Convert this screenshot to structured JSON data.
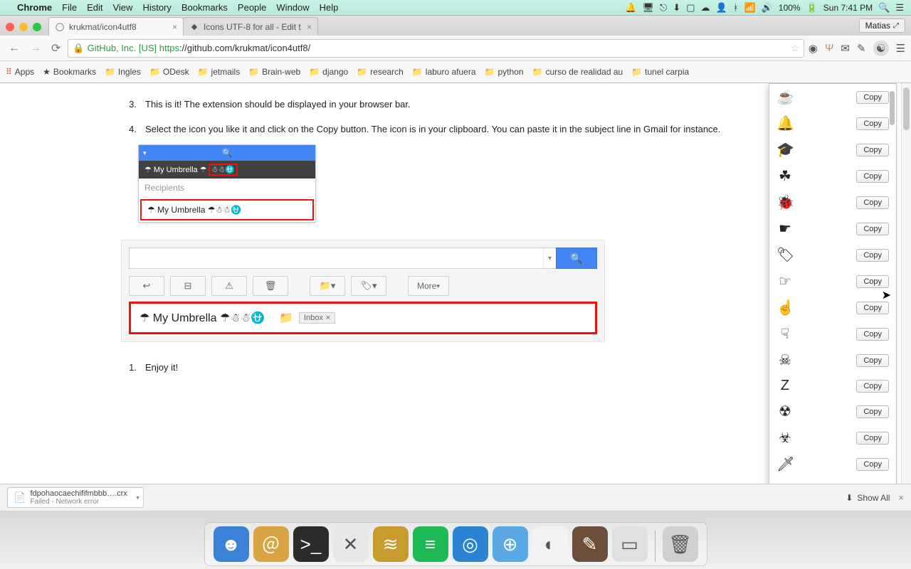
{
  "menubar": {
    "app": "Chrome",
    "items": [
      "File",
      "Edit",
      "View",
      "History",
      "Bookmarks",
      "People",
      "Window",
      "Help"
    ],
    "battery": "100%",
    "clock": "Sun 7:41 PM"
  },
  "chrome": {
    "tabs": [
      {
        "title": "krukmat/icon4utf8"
      },
      {
        "title": "Icons UTF-8 for all - Edit t"
      }
    ],
    "profile": "Matias",
    "url_secure": "GitHub, Inc. [US]",
    "url_prefix": "https",
    "url_rest": "://github.com/krukmat/icon4utf8/",
    "bookmarks": [
      "Apps",
      "Bookmarks",
      "Ingles",
      "ODesk",
      "jetmails",
      "Brain-web",
      "django",
      "research",
      "laburo afuera",
      "python",
      "curso de realidad au",
      "tunel carpia"
    ]
  },
  "page": {
    "step3_num": "3.",
    "step3": "This is it! The extension should be displayed in your browser bar.",
    "step4_num": "4.",
    "step4": "Select the icon you like it and click on the Copy button. The icon is in your clipboard. You can paste it in the subject line in Gmail for instance.",
    "compose_subject_dark": "☂ My Umbrella ☂",
    "compose_subject_icons": "☃☃⛎",
    "recipients_label": "Recipients",
    "compose_subject_line": "☂ My Umbrella ☂☃☃⛎",
    "inbox_subject": "☂ My Umbrella ☂☃☃⛎",
    "inbox_label": "Inbox",
    "more_label": "More",
    "enjoy_num": "1.",
    "enjoy": "Enjoy it!"
  },
  "extension": {
    "copy_label": "Copy",
    "icons": [
      "☕",
      "🔔",
      "🎓",
      "☘",
      "🐞",
      "☛",
      "🏷",
      "☞",
      "☝",
      "☟",
      "☠",
      "Z",
      "☢",
      "☣",
      "🗡"
    ]
  },
  "downloads": {
    "file": "fdpohaocaechififmbbb….crx",
    "status": "Failed - Network error",
    "showall": "Show All"
  },
  "dock": {
    "apps": [
      {
        "bg": "#3b82d7",
        "glyph": "☻"
      },
      {
        "bg": "#d9a441",
        "glyph": "＠"
      },
      {
        "bg": "#2b2b2b",
        "glyph": ">_"
      },
      {
        "bg": "#e8e8e8",
        "glyph": "✕"
      },
      {
        "bg": "#c99a2e",
        "glyph": "≋"
      },
      {
        "bg": "#1db954",
        "glyph": "≡"
      },
      {
        "bg": "#2a84d2",
        "glyph": "◎"
      },
      {
        "bg": "#5aa9e6",
        "glyph": "⊕"
      },
      {
        "bg": "#f2f2f2",
        "glyph": "◐"
      },
      {
        "bg": "#6b4f3a",
        "glyph": "✎"
      },
      {
        "bg": "#e0e0e0",
        "glyph": "▭"
      },
      {
        "bg": "#d0d0d0",
        "glyph": "🗑"
      }
    ]
  }
}
